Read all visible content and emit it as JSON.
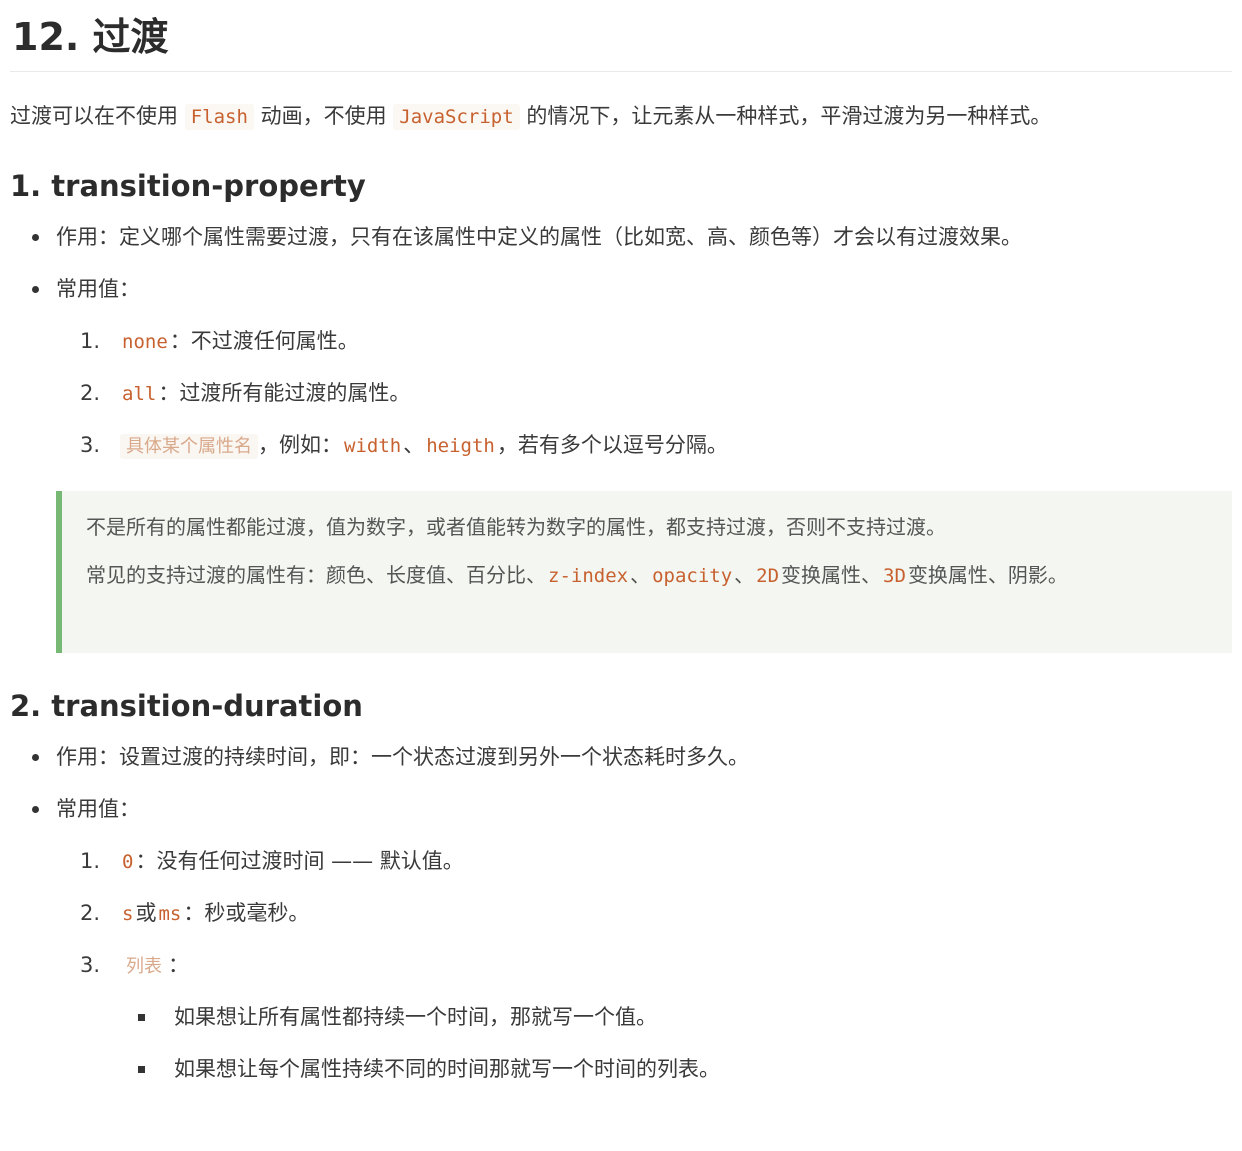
{
  "title": "12. 过渡",
  "intro": {
    "t1": "过渡可以在不使用 ",
    "c1": "Flash",
    "t2": " 动画，不使用 ",
    "c2": "JavaScript",
    "t3": " 的情况下，让元素从一种样式，平滑过渡为另一种样式。"
  },
  "section1": {
    "heading": "1. transition-property",
    "bullet1": "作用：定义哪个属性需要过渡，只有在该属性中定义的属性（比如宽、高、颜色等）才会以有过渡效果。",
    "bullet2": "常用值：",
    "items": [
      {
        "num": "1.",
        "code": "none",
        "text": "：不过渡任何属性。"
      },
      {
        "num": "2.",
        "code": "all",
        "text": "：过渡所有能过渡的属性。"
      },
      {
        "num": "3.",
        "code": "具体某个属性名",
        "sep1": "，例如：",
        "code2": "width",
        "sep2": "、",
        "code3": "heigth",
        "text": "，若有多个以逗号分隔。"
      }
    ],
    "note": {
      "line1": "不是所有的属性都能过渡，值为数字，或者值能转为数字的属性，都支持过渡，否则不支持过渡。",
      "line2_a": "常见的支持过渡的属性有：颜色、长度值、百分比、",
      "line2_c1": "z-index",
      "line2_b": "、",
      "line2_c2": "opacity",
      "line2_d": "、",
      "line2_c3": "2D",
      "line2_e": "变换属性、",
      "line2_c4": "3D",
      "line2_f": "变换属性、阴影。"
    }
  },
  "section2": {
    "heading": "2. transition-duration",
    "bullet1": "作用：设置过渡的持续时间，即：一个状态过渡到另外一个状态耗时多久。",
    "bullet2": "常用值：",
    "items": [
      {
        "num": "1.",
        "code": "0",
        "text": "：没有任何过渡时间 —— 默认值。"
      },
      {
        "num": "2.",
        "code": "s",
        "mid": "或",
        "code2": "ms",
        "text": "：秒或毫秒。"
      },
      {
        "num": "3.",
        "code": "列表",
        "text": "："
      }
    ],
    "subitems": [
      "如果想让所有属性都持续一个时间，那就写一个值。",
      "如果想让每个属性持续不同的时间那就写一个时间的列表。"
    ]
  }
}
